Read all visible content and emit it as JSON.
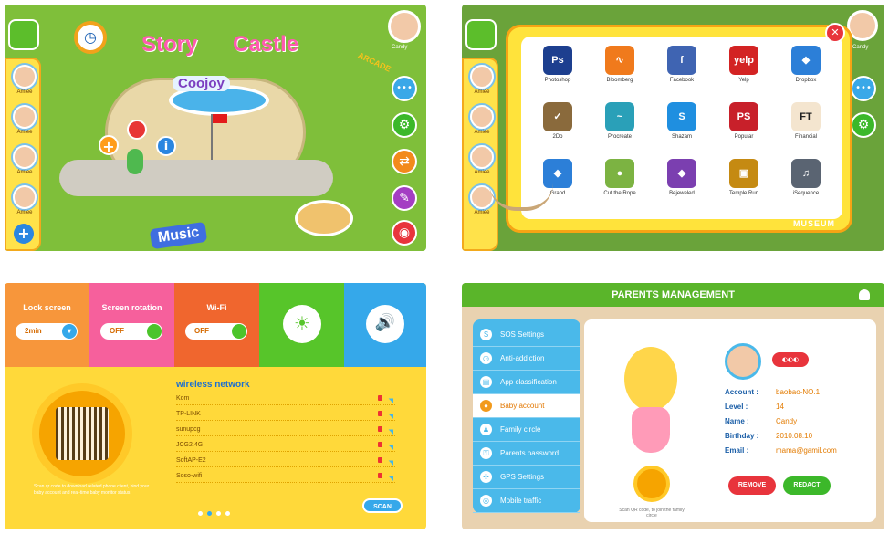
{
  "panel1": {
    "title_story": "Story",
    "title_castle": "Castle",
    "sign_text": "Coojoy",
    "music_sign": "Music",
    "user_name": "Candy",
    "arcade_sign": "ARCADE",
    "sidebar": {
      "items": [
        {
          "label": "Amiee"
        },
        {
          "label": "Amiee"
        },
        {
          "label": "Amiee"
        },
        {
          "label": "Amiee"
        }
      ]
    },
    "buttons": {
      "more": "•••",
      "settings": "⚙",
      "switch": "⇄",
      "brush": "✎",
      "camera": "◉",
      "add": "+",
      "info": "i"
    }
  },
  "panel2": {
    "user_name": "Candy",
    "close": "✕",
    "footer": "MUSEUM",
    "sidebar": {
      "items": [
        {
          "label": "Amiee"
        },
        {
          "label": "Amiee"
        },
        {
          "label": "Amiee"
        },
        {
          "label": "Amiee"
        }
      ]
    },
    "apps": [
      {
        "name": "Photoshop",
        "glyph": "Ps",
        "color": "#1d3f8f"
      },
      {
        "name": "Bloomberg",
        "glyph": "∿",
        "color": "#f07a1c"
      },
      {
        "name": "Facebook",
        "glyph": "f",
        "color": "#3f64b2"
      },
      {
        "name": "Yelp",
        "glyph": "yelp",
        "color": "#d32323"
      },
      {
        "name": "Dropbox",
        "glyph": "◆",
        "color": "#2c7fd8"
      },
      {
        "name": "2Do",
        "glyph": "✓",
        "color": "#8a6a3c"
      },
      {
        "name": "Procreate",
        "glyph": "~",
        "color": "#2aa0b8"
      },
      {
        "name": "Shazam",
        "glyph": "S",
        "color": "#1f8fe0"
      },
      {
        "name": "Popular",
        "glyph": "PS",
        "color": "#c8202a"
      },
      {
        "name": "Financial",
        "glyph": "FT",
        "color": "#f4e5cf"
      },
      {
        "name": "Grand",
        "glyph": "◆",
        "color": "#2c7fd8"
      },
      {
        "name": "Cut the Rope",
        "glyph": "●",
        "color": "#7cb342"
      },
      {
        "name": "Bejeweled",
        "glyph": "◆",
        "color": "#7b3fb0"
      },
      {
        "name": "Temple Run",
        "glyph": "▣",
        "color": "#c58a12"
      },
      {
        "name": "iSequence",
        "glyph": "♫",
        "color": "#5a6472"
      }
    ]
  },
  "panel3": {
    "tiles": [
      {
        "label": "Lock screen",
        "value": "2min",
        "color": "#f7963b"
      },
      {
        "label": "Screen rotation",
        "value": "OFF",
        "color": "#f6609c"
      },
      {
        "label": "Wi-Fi",
        "value": "OFF",
        "color": "#f0662e"
      },
      {
        "label": "",
        "value": "☀",
        "color": "#57c52a"
      },
      {
        "label": "",
        "value": "🔊",
        "color": "#35a8ea"
      }
    ],
    "network_title": "wireless network",
    "networks": [
      "Kom",
      "TP-LINK",
      "sunupcg",
      "JCG2.4G",
      "SoftAP-E2",
      "Soso-wifi"
    ],
    "scan_caption": "Scan qr code to download related phone client, bind your baby account and real-time baby monitor status",
    "scan_button": "SCAN"
  },
  "panel4": {
    "header": "PARENTS MANAGEMENT",
    "menu": [
      {
        "label": "SOS Settings",
        "icon": "S"
      },
      {
        "label": "Anti-addiction",
        "icon": "◷"
      },
      {
        "label": "App classification",
        "icon": "▤"
      },
      {
        "label": "Baby account",
        "icon": "●"
      },
      {
        "label": "Family circle",
        "icon": "♟"
      },
      {
        "label": "Parents password",
        "icon": "⚿"
      },
      {
        "label": "GPS Settings",
        "icon": "✣"
      },
      {
        "label": "Mobile traffic",
        "icon": "◎"
      }
    ],
    "active_index": 3,
    "account": {
      "account_label": "Account :",
      "account_value": "baobao-NO.1",
      "level_label": "Level :",
      "level_value": "14",
      "name_label": "Name :",
      "name_value": "Candy",
      "birthday_label": "Birthday :",
      "birthday_value": "2010.08.10",
      "email_label": "Email :",
      "email_value": "mama@gamil.com"
    },
    "qr_caption": "Scan QR code, to join the family circle",
    "remove_button": "REMOVE",
    "redact_button": "REDACT"
  }
}
